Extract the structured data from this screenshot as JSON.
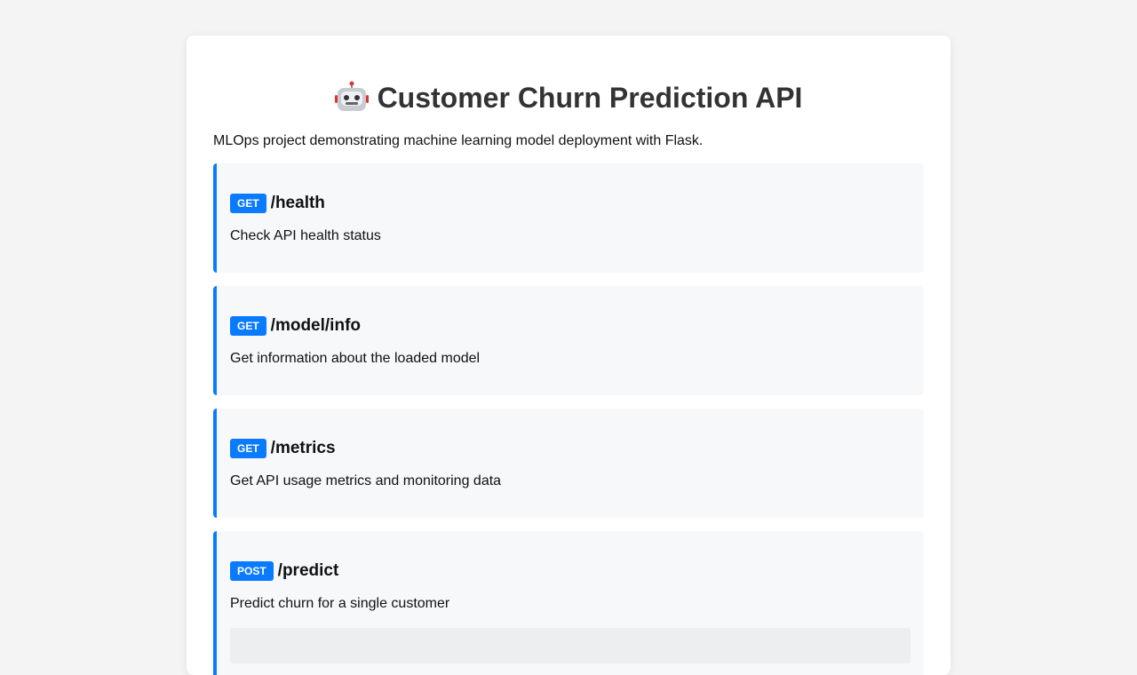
{
  "header": {
    "title": "Customer Churn Prediction API",
    "icon": "robot-icon",
    "subtitle": "MLOps project demonstrating machine learning model deployment with Flask."
  },
  "colors": {
    "accent": "#0a7bff",
    "background": "#f4f4f4",
    "card": "#ffffff",
    "endpoint_bg": "#f7f8fa"
  },
  "endpoints": [
    {
      "method": "GET",
      "path": "/health",
      "description": "Check API health status"
    },
    {
      "method": "GET",
      "path": "/model/info",
      "description": "Get information about the loaded model"
    },
    {
      "method": "GET",
      "path": "/metrics",
      "description": "Get API usage metrics and monitoring data"
    },
    {
      "method": "POST",
      "path": "/predict",
      "description": "Predict churn for a single customer"
    }
  ]
}
